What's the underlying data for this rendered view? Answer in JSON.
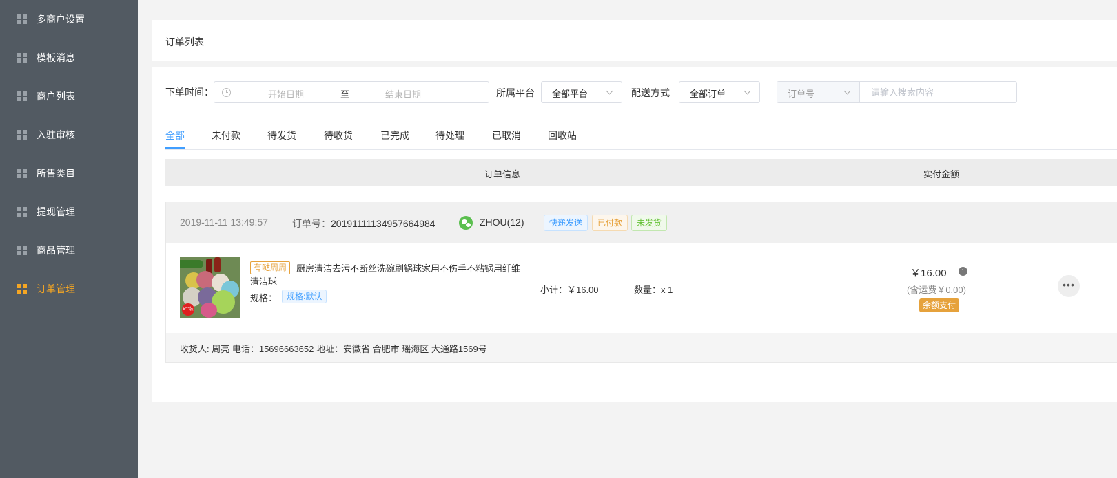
{
  "sidebar": {
    "items": [
      {
        "label": "多商户设置",
        "icon": "grid-icon"
      },
      {
        "label": "模板消息",
        "icon": "grid-icon"
      },
      {
        "label": "商户列表",
        "icon": "grid-icon"
      },
      {
        "label": "入驻审核",
        "icon": "grid-icon"
      },
      {
        "label": "所售类目",
        "icon": "grid-icon"
      },
      {
        "label": "提现管理",
        "icon": "grid-icon"
      },
      {
        "label": "商品管理",
        "icon": "grid-icon"
      },
      {
        "label": "订单管理",
        "icon": "grid-icon",
        "active": true
      }
    ],
    "active_color": "#f5a623"
  },
  "page": {
    "title": "订单列表"
  },
  "filters": {
    "order_time_label": "下单时间：",
    "start_placeholder": "开始日期",
    "range_separator": "至",
    "end_placeholder": "结束日期",
    "platform_label": "所属平台",
    "platform_value": "全部平台",
    "delivery_label": "配送方式",
    "delivery_value": "全部订单",
    "search_field_value": "订单号",
    "search_placeholder": "请输入搜索内容"
  },
  "tabs": [
    "全部",
    "未付款",
    "待发货",
    "待收货",
    "已完成",
    "待处理",
    "已取消",
    "回收站"
  ],
  "table": {
    "headers": [
      "订单信息",
      "实付金额"
    ]
  },
  "order": {
    "time": "2019-11-11 13:49:57",
    "order_no_label": "订单号：",
    "order_no": "20191111134957664984",
    "user": "ZHOU(12)",
    "badges": [
      "快递发送",
      "已付款",
      "未发货"
    ],
    "shop_tag": "有哒周周",
    "product_name": "厨房清洁去污不断丝洗碗刷锅球家用不伤手不粘锅用纤维清洁球",
    "spec_label": "规格：",
    "spec_value": "规格:默认",
    "thumb_tag": "5个装",
    "subtotal": "小计：￥16.00",
    "quantity": "数量：x 1",
    "price": "￥16.00",
    "freight": "(含运费￥0.00)",
    "pay_method": "余额支付",
    "more": "•••",
    "receiver": "收货人: 周亮 电话：15696663652 地址：安徽省 合肥市 瑶海区 大通路1569号"
  },
  "colors": {
    "accent": "#409eff",
    "warning": "#e6a23c",
    "success": "#67c23a",
    "sidebar_bg": "#525a62"
  }
}
